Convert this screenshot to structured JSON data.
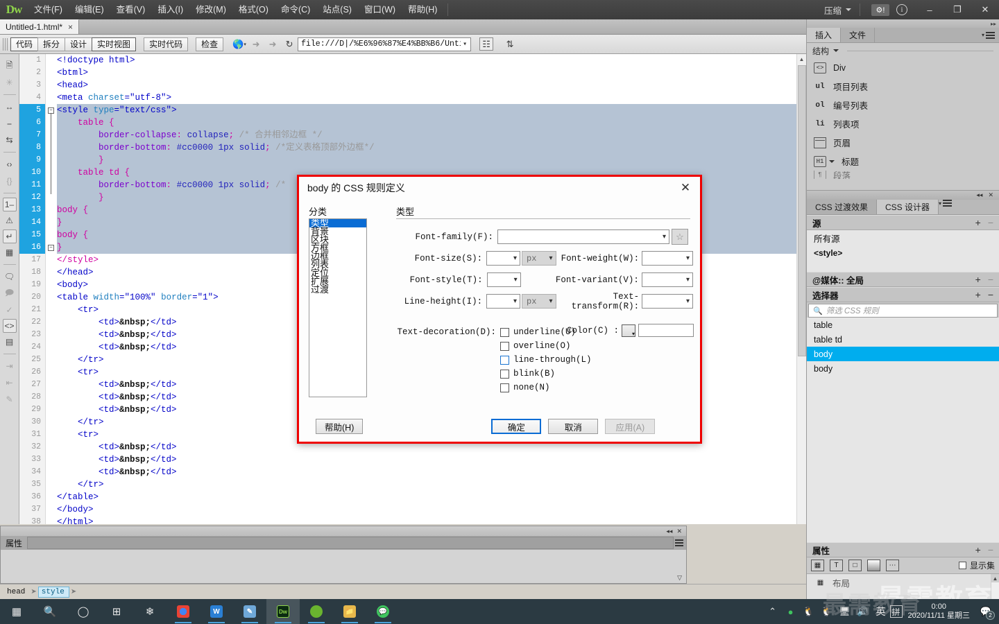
{
  "titlebar": {
    "logo": "Dw",
    "menus": [
      "文件(F)",
      "编辑(E)",
      "查看(V)",
      "插入(I)",
      "修改(M)",
      "格式(O)",
      "命令(C)",
      "站点(S)",
      "窗口(W)",
      "帮助(H)"
    ],
    "workspace_label": "压缩",
    "gear_icon": "gear-alert-icon",
    "info_icon": "info-icon",
    "minimize": "–",
    "maximize": "❐",
    "close": "✕"
  },
  "tabbar": {
    "doc_tab": "Untitled-1.html*",
    "close_glyph": "×",
    "filepath": "D:\\文件\\Untitled-1.html"
  },
  "doctoolbar": {
    "views": [
      "代码",
      "拆分",
      "设计",
      "实时视图"
    ],
    "selected_view": "代码",
    "live_code": "实时代码",
    "inspect": "检查",
    "globe_icon": "globe-icon",
    "back_icon": "arrow-left-icon",
    "forward_icon": "arrow-right-icon",
    "refresh_icon": "refresh-icon",
    "url": "file:///D|/%E6%96%87%E4%BB%B6/Untitled",
    "grid_icon": "grid-view-icon",
    "sync_icon": "file-sync-icon"
  },
  "codetools": {
    "icons": [
      "new-document-icon",
      "snippet-icon",
      "expand-all-icon",
      "collapse-selection-icon",
      "collapse-outside-icon",
      "select-parent-tag-icon",
      "balance-braces-icon",
      "line-numbers-icon",
      "highlight-invalid-icon",
      "word-wrap-icon",
      "syntax-color-icon",
      "apply-comment-icon",
      "remove-comment-icon",
      "wrap-tag-icon",
      "recent-snippet-icon",
      "move-css-icon",
      "indent-icon",
      "outdent-icon",
      "format-source-icon"
    ]
  },
  "code": {
    "selected_from": 5,
    "selected_to": 16,
    "lines": [
      {
        "n": 1,
        "html": "<span class='tagc'>&lt;!doctype html&gt;</span>"
      },
      {
        "n": 2,
        "html": "<span class='tagc'>&lt;btml&gt;</span>"
      },
      {
        "n": 3,
        "html": "<span class='tagc'>&lt;head&gt;</span>"
      },
      {
        "n": 4,
        "html": "<span class='tagc'>&lt;meta </span><span class='attr'>charset</span><span class='tagc'>=</span><span class='val'>\"utf-8\"</span><span class='tagc'>&gt;</span>"
      },
      {
        "n": 5,
        "html": "<span class='tagc'>&lt;style </span><span class='attr'>type</span><span class='tagc'>=</span><span class='val'>\"text/css\"</span><span class='tagc'>&gt;</span>"
      },
      {
        "n": 6,
        "html": "    <span class='sel-c'>table {</span>"
      },
      {
        "n": 7,
        "html": "        <span class='prop'>border-collapse</span><span class='punc'>:</span> <span class='pval'>collapse</span><span class='punc'>;</span> <span class='cmt'>/* 合并相邻边框 */</span>"
      },
      {
        "n": 8,
        "html": "        <span class='prop'>border-bottom</span><span class='punc'>:</span> <span class='pval'>#cc0000 1px solid</span><span class='punc'>;</span> <span class='cmt'>/*定义表格顶部外边框*/</span>"
      },
      {
        "n": 9,
        "html": "        <span class='sel-c'>}</span>"
      },
      {
        "n": 10,
        "html": "    <span class='sel-c'>table td {</span>"
      },
      {
        "n": 11,
        "html": "        <span class='prop'>border-bottom</span><span class='punc'>:</span> <span class='pval'>#cc0000 1px solid</span><span class='punc'>;</span> <span class='cmt'>/*</span>"
      },
      {
        "n": 12,
        "html": "        <span class='sel-c'>}</span>"
      },
      {
        "n": 13,
        "html": "<span class='sel-c'>body {</span>"
      },
      {
        "n": 14,
        "html": "<span class='sel-c'>}</span>"
      },
      {
        "n": 15,
        "html": "<span class='sel-c'>body {</span>"
      },
      {
        "n": 16,
        "html": "<span class='sel-c'>}</span>"
      },
      {
        "n": 17,
        "html": "<span class='sel-c'>&lt;/style&gt;</span>"
      },
      {
        "n": 18,
        "html": "<span class='tagc'>&lt;/head&gt;</span>"
      },
      {
        "n": 19,
        "html": "<span class='tagc'>&lt;body&gt;</span>"
      },
      {
        "n": 20,
        "html": "<span class='tagc'>&lt;table </span><span class='attr'>width</span><span class='tagc'>=</span><span class='val'>\"100%\"</span><span class='tagc'> </span><span class='attr'>border</span><span class='tagc'>=</span><span class='val'>\"1\"</span><span class='tagc'>&gt;</span>"
      },
      {
        "n": 21,
        "html": "    <span class='tagc'>&lt;tr&gt;</span>"
      },
      {
        "n": 22,
        "html": "        <span class='tagc'>&lt;td&gt;</span><span class='ent'>&amp;nbsp;</span><span class='tagc'>&lt;/td&gt;</span>"
      },
      {
        "n": 23,
        "html": "        <span class='tagc'>&lt;td&gt;</span><span class='ent'>&amp;nbsp;</span><span class='tagc'>&lt;/td&gt;</span>"
      },
      {
        "n": 24,
        "html": "        <span class='tagc'>&lt;td&gt;</span><span class='ent'>&amp;nbsp;</span><span class='tagc'>&lt;/td&gt;</span>"
      },
      {
        "n": 25,
        "html": "    <span class='tagc'>&lt;/tr&gt;</span>"
      },
      {
        "n": 26,
        "html": "    <span class='tagc'>&lt;tr&gt;</span>"
      },
      {
        "n": 27,
        "html": "        <span class='tagc'>&lt;td&gt;</span><span class='ent'>&amp;nbsp;</span><span class='tagc'>&lt;/td&gt;</span>"
      },
      {
        "n": 28,
        "html": "        <span class='tagc'>&lt;td&gt;</span><span class='ent'>&amp;nbsp;</span><span class='tagc'>&lt;/td&gt;</span>"
      },
      {
        "n": 29,
        "html": "        <span class='tagc'>&lt;td&gt;</span><span class='ent'>&amp;nbsp;</span><span class='tagc'>&lt;/td&gt;</span>"
      },
      {
        "n": 30,
        "html": "    <span class='tagc'>&lt;/tr&gt;</span>"
      },
      {
        "n": 31,
        "html": "    <span class='tagc'>&lt;tr&gt;</span>"
      },
      {
        "n": 32,
        "html": "        <span class='tagc'>&lt;td&gt;</span><span class='ent'>&amp;nbsp;</span><span class='tagc'>&lt;/td&gt;</span>"
      },
      {
        "n": 33,
        "html": "        <span class='tagc'>&lt;td&gt;</span><span class='ent'>&amp;nbsp;</span><span class='tagc'>&lt;/td&gt;</span>"
      },
      {
        "n": 34,
        "html": "        <span class='tagc'>&lt;td&gt;</span><span class='ent'>&amp;nbsp;</span><span class='tagc'>&lt;/td&gt;</span>"
      },
      {
        "n": 35,
        "html": "    <span class='tagc'>&lt;/tr&gt;</span>"
      },
      {
        "n": 36,
        "html": "<span class='tagc'>&lt;/table&gt;</span>"
      },
      {
        "n": 37,
        "html": "<span class='tagc'>&lt;/body&gt;</span>"
      },
      {
        "n": 38,
        "html": "<span class='tagc'>&lt;/html&gt;</span>"
      }
    ]
  },
  "properties_panel": {
    "title": "属性"
  },
  "statusbar": {
    "tags": [
      "head",
      "style"
    ],
    "active_tag": "style"
  },
  "right_dock": {
    "tabs": [
      "插入",
      "文件"
    ],
    "active_tab": "插入",
    "structure_label": "结构",
    "insert_items": [
      {
        "icon": "code-div-icon",
        "label": "Div"
      },
      {
        "icon": "ul-icon",
        "label": "项目列表"
      },
      {
        "icon": "ol-icon",
        "label": "编号列表"
      },
      {
        "icon": "li-icon",
        "label": "列表项"
      },
      {
        "icon": "header-icon",
        "label": "页眉"
      },
      {
        "icon": "heading-icon",
        "label": "标题"
      },
      {
        "icon": "paragraph-icon",
        "label": "段落"
      }
    ],
    "css_tabs": [
      "CSS 过渡效果",
      "CSS 设计器"
    ],
    "css_active_tab": "CSS 设计器",
    "sources": {
      "header": "源",
      "items": [
        "所有源",
        "<style>"
      ]
    },
    "media": {
      "header": "@媒体:: 全局"
    },
    "selectors": {
      "header": "选择器",
      "filter_placeholder": "筛选 CSS 规则",
      "items": [
        "table",
        "table td",
        "body",
        "body"
      ],
      "active_index": 2
    },
    "attributes": {
      "header": "属性",
      "tool_icons": [
        "layout-icon",
        "text-icon",
        "border-icon",
        "background-icon",
        "more-icon"
      ],
      "show_set_label": "显示集",
      "row_icon": "layout-icon",
      "row_label": "布局"
    }
  },
  "dialog": {
    "title": "body 的 CSS 规则定义",
    "close_glyph": "✕",
    "category_label": "分类",
    "categories": [
      "类型",
      "背景",
      "区块",
      "方框",
      "边框",
      "列表",
      "定位",
      "扩展",
      "过渡"
    ],
    "selected_category": "类型",
    "section_title": "类型",
    "fields": {
      "font_family": {
        "label": "Font-family(F):",
        "value": ""
      },
      "font_size": {
        "label": "Font-size(S):",
        "value": "",
        "unit": "px"
      },
      "font_weight": {
        "label": "Font-weight(W):",
        "value": ""
      },
      "font_style": {
        "label": "Font-style(T):",
        "value": ""
      },
      "font_variant": {
        "label": "Font-variant(V):",
        "value": ""
      },
      "line_height": {
        "label": "Line-height(I):",
        "value": "",
        "unit": "px"
      },
      "text_transform": {
        "label": "Text-transform(R):",
        "value": ""
      },
      "text_decoration": {
        "label": "Text-decoration(D):"
      },
      "color": {
        "label": "Color(C) :",
        "value": ""
      }
    },
    "decorations": [
      {
        "label": "underline(U)",
        "checked": false
      },
      {
        "label": "overline(O)",
        "checked": false
      },
      {
        "label": "line-through(L)",
        "checked": false
      },
      {
        "label": "blink(B)",
        "checked": false
      },
      {
        "label": "none(N)",
        "checked": false
      }
    ],
    "buttons": {
      "help": "帮助(H)",
      "ok": "确定",
      "cancel": "取消",
      "apply": "应用(A)"
    },
    "accent_border": "#ee0000",
    "focus_color": "#0a6cd4"
  },
  "watermark": {
    "text": "最需教育"
  },
  "taskbar": {
    "items": [
      {
        "icon": "windows-start-icon",
        "label": "start"
      },
      {
        "icon": "search-icon",
        "label": "search"
      },
      {
        "icon": "cortana-icon",
        "label": "cortana"
      },
      {
        "icon": "task-view-icon",
        "label": "task-view"
      },
      {
        "icon": "pinwheel-icon",
        "label": "app"
      },
      {
        "icon": "chrome-icon",
        "label": "Chrome"
      },
      {
        "icon": "wps-icon",
        "label": "WPS"
      },
      {
        "icon": "notepad-icon",
        "label": "Editor"
      },
      {
        "icon": "dreamweaver-icon",
        "label": "Dw"
      },
      {
        "icon": "watermelon-icon",
        "label": "app"
      },
      {
        "icon": "explorer-icon",
        "label": "Explorer"
      },
      {
        "icon": "wechat-icon",
        "label": "WeChat"
      }
    ],
    "tray": {
      "chevron": "⌃",
      "icons": [
        "wechat-tray-icon",
        "qq-icon",
        "qq-pink-icon",
        "network-icon",
        "volume-icon"
      ],
      "ime": "英",
      "ime_mode": "拼",
      "time": "0:00",
      "date": "2020/11/11 星期三",
      "notification_count": "2"
    }
  }
}
